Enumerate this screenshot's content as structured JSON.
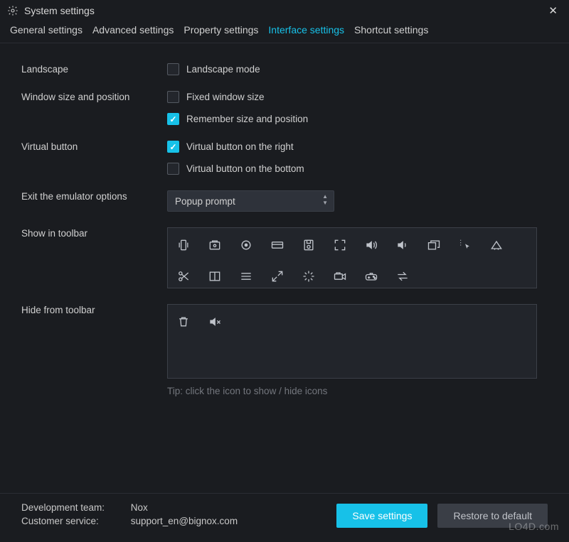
{
  "title": "System settings",
  "tabs": [
    {
      "label": "General settings"
    },
    {
      "label": "Advanced settings"
    },
    {
      "label": "Property settings"
    },
    {
      "label": "Interface settings",
      "active": true
    },
    {
      "label": "Shortcut settings"
    }
  ],
  "rows": {
    "landscape": {
      "label": "Landscape",
      "checkbox": {
        "label": "Landscape mode",
        "checked": false
      }
    },
    "window_size": {
      "label": "Window size and position",
      "checkboxes": [
        {
          "label": "Fixed window size",
          "checked": false
        },
        {
          "label": "Remember size and position",
          "checked": true
        }
      ]
    },
    "virtual_button": {
      "label": "Virtual button",
      "checkboxes": [
        {
          "label": "Virtual button on the right",
          "checked": true
        },
        {
          "label": "Virtual button on the bottom",
          "checked": false
        }
      ]
    },
    "exit": {
      "label": "Exit the emulator options",
      "select_value": "Popup prompt"
    },
    "show_toolbar": {
      "label": "Show in toolbar"
    },
    "hide_toolbar": {
      "label": "Hide from toolbar"
    }
  },
  "toolbar_show_icons": [
    "shake-icon",
    "screenshot-icon",
    "location-icon",
    "keyboard-layout-icon",
    "save-disk-icon",
    "fullscreen-icon",
    "volume-up-icon",
    "volume-down-icon",
    "multi-window-icon",
    "cursor-settings-icon",
    "apk-install-icon",
    "scissors-icon",
    "split-icon",
    "menu-icon",
    "expand-icon",
    "loading-icon",
    "record-icon",
    "controller-icon",
    "transfer-icon"
  ],
  "toolbar_hide_icons": [
    "trash-icon",
    "mute-icon"
  ],
  "tip": "Tip: click the icon to show / hide icons",
  "footer": {
    "dev_label": "Development team:",
    "dev_value": "Nox",
    "cs_label": "Customer service:",
    "cs_value": "support_en@bignox.com",
    "save": "Save settings",
    "restore": "Restore to default"
  },
  "watermark": "LO4D.com"
}
